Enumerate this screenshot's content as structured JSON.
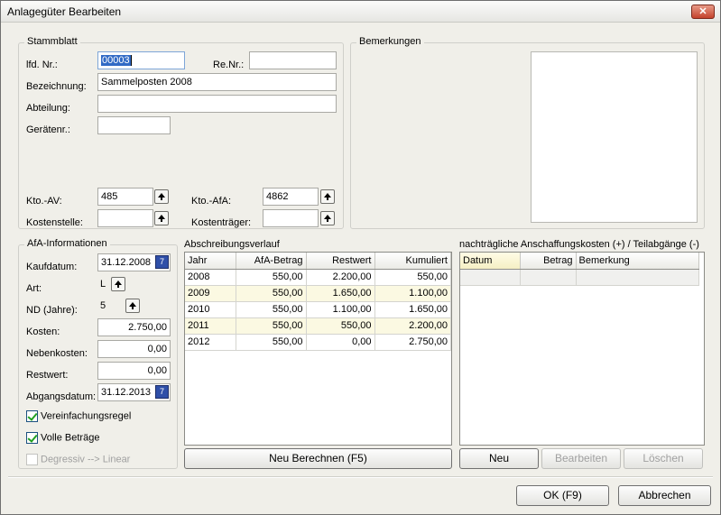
{
  "window": {
    "title": "Anlagegüter Bearbeiten",
    "close_glyph": "✕"
  },
  "stammblatt": {
    "legend": "Stammblatt",
    "lfd_nr_label": "lfd. Nr.:",
    "lfd_nr_value": "00003",
    "re_nr_label": "Re.Nr.:",
    "re_nr_value": "",
    "bezeichnung_label": "Bezeichnung:",
    "bezeichnung_value": "Sammelposten 2008",
    "abteilung_label": "Abteilung:",
    "abteilung_value": "",
    "geraetenr_label": "Gerätenr.:",
    "geraetenr_value": "",
    "kto_av_label": "Kto.-AV:",
    "kto_av_value": "485",
    "kto_afa_label": "Kto.-AfA:",
    "kto_afa_value": "4862",
    "kostenstelle_label": "Kostenstelle:",
    "kostenstelle_value": "",
    "kostentraeger_label": "Kostenträger:",
    "kostentraeger_value": ""
  },
  "bemerkungen": {
    "legend": "Bemerkungen",
    "value": ""
  },
  "afa": {
    "legend": "AfA-Informationen",
    "kaufdatum_label": "Kaufdatum:",
    "kaufdatum_value": "31.12.2008",
    "art_label": "Art:",
    "art_value": "L",
    "nd_label": "ND (Jahre):",
    "nd_value": "5",
    "kosten_label": "Kosten:",
    "kosten_value": "2.750,00",
    "nebenkosten_label": "Nebenkosten:",
    "nebenkosten_value": "0,00",
    "restwert_label": "Restwert:",
    "restwert_value": "0,00",
    "abgangsdatum_label": "Abgangsdatum:",
    "abgangsdatum_value": "31.12.2013",
    "calendar_glyph": "7",
    "vereinfachungsregel_label": "Vereinfachungsregel",
    "vereinfachungsregel_checked": true,
    "volle_betraege_label": "Volle Beträge",
    "volle_betraege_checked": true,
    "degressiv_label": "Degressiv --> Linear",
    "degressiv_checked": false
  },
  "abschreibung": {
    "label": "Abschreibungsverlauf",
    "columns": [
      "Jahr",
      "AfA-Betrag",
      "Restwert",
      "Kumuliert"
    ],
    "rows": [
      [
        "2008",
        "550,00",
        "2.200,00",
        "550,00"
      ],
      [
        "2009",
        "550,00",
        "1.650,00",
        "1.100,00"
      ],
      [
        "2010",
        "550,00",
        "1.100,00",
        "1.650,00"
      ],
      [
        "2011",
        "550,00",
        "550,00",
        "2.200,00"
      ],
      [
        "2012",
        "550,00",
        "0,00",
        "2.750,00"
      ]
    ],
    "button_label": "Neu Berechnen (F5)"
  },
  "nachtraeglich": {
    "label": "nachträgliche Anschaffungskosten (+) / Teilabgänge (-)",
    "columns": [
      "Datum",
      "Betrag",
      "Bemerkung"
    ],
    "rows": [
      [
        "",
        "",
        ""
      ]
    ],
    "neu_label": "Neu",
    "bearbeiten_label": "Bearbeiten",
    "loeschen_label": "Löschen"
  },
  "footer": {
    "ok_label": "OK (F9)",
    "abbrechen_label": "Abbrechen"
  }
}
